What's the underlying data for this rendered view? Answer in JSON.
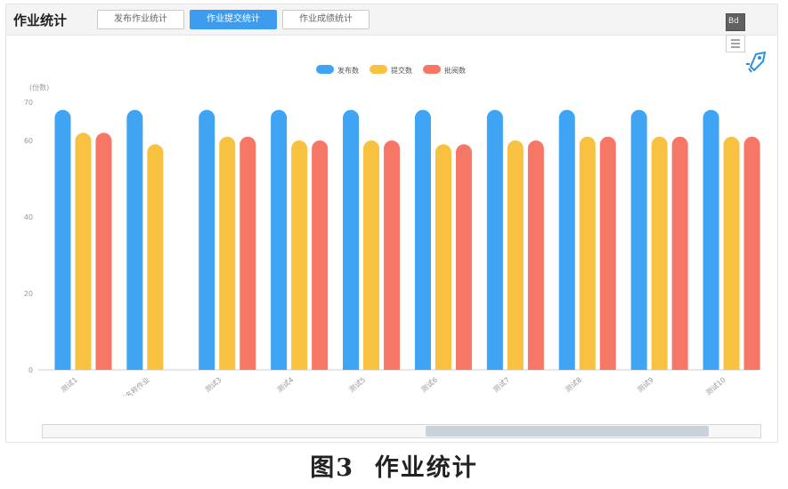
{
  "header": {
    "title": "作业统计",
    "tabs": [
      {
        "label": "发布作业统计",
        "active": false
      },
      {
        "label": "作业提交统计",
        "active": true
      },
      {
        "label": "作业成绩统计",
        "active": false
      }
    ]
  },
  "toolbar": {
    "dark_label": "Bd"
  },
  "caption": {
    "label": "图",
    "number": "3",
    "text": "作业统计"
  },
  "colors": {
    "series_1": "#3fa4f3",
    "series_2": "#f8c13f",
    "series_3": "#f77767",
    "axis": "#cccccc",
    "label": "#999999"
  },
  "chart_data": {
    "type": "bar",
    "y_axis_name": "(份数)",
    "ylim": [
      0,
      70
    ],
    "yticks": [
      0,
      20,
      40,
      60,
      70
    ],
    "grid": false,
    "legend_position": "top-center",
    "categories": [
      "测试1",
      "新名称作业",
      "测试3",
      "测试4",
      "测试5",
      "测试6",
      "测试7",
      "测试8",
      "测试9",
      "测试10"
    ],
    "series": [
      {
        "name": "发布数",
        "values": [
          68,
          68,
          68,
          68,
          68,
          68,
          68,
          68,
          68,
          68
        ]
      },
      {
        "name": "提交数",
        "values": [
          62,
          59,
          61,
          60,
          60,
          59,
          60,
          61,
          61,
          61
        ]
      },
      {
        "name": "批阅数",
        "values": [
          62,
          0,
          61,
          60,
          60,
          59,
          60,
          61,
          61,
          61
        ]
      }
    ]
  }
}
